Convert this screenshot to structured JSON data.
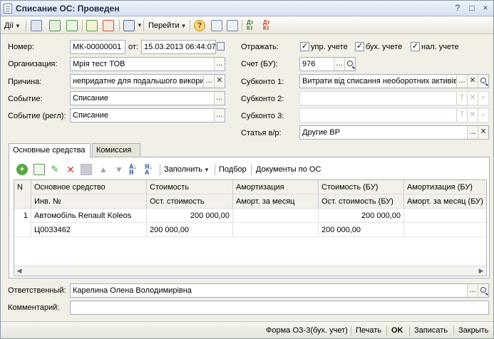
{
  "window": {
    "title": "Списание ОС: Проведен",
    "controls": [
      "?",
      "□",
      "×"
    ]
  },
  "toolbar": {
    "actions_label": "Дії",
    "goto_label": "Перейти",
    "help_label": "?",
    "dt_kt_label": "Дт Кт",
    "dt_kt_n_label": "Дт Кт"
  },
  "header": {
    "number_label": "Номер:",
    "number_value": "МК-00000001",
    "from_label": "от:",
    "date_value": "15.03.2013 06:44:07",
    "org_label": "Организация:",
    "org_value": "Мрія тест ТОВ",
    "reason_label": "Причина:",
    "reason_value": "непридатне для подальшого викори",
    "event_label": "Событие:",
    "event_value": "Списание",
    "event_reg_label": "Событие (регл):",
    "event_reg_value": "Списание",
    "reflect_label": "Отражать:",
    "reflect_options": [
      {
        "label": "упр. учете",
        "checked": true
      },
      {
        "label": "бух. учете",
        "checked": true
      },
      {
        "label": "нал. учете",
        "checked": true
      }
    ],
    "account_label": "Счет (БУ):",
    "account_value": "976",
    "subconto1_label": "Субконто 1:",
    "subconto1_value": "Витрати від списання необоротних активів",
    "subconto2_label": "Субконто 2:",
    "subconto2_value": "",
    "subconto3_label": "Субконто 3:",
    "subconto3_value": "",
    "article_label": "Статья в/р:",
    "article_value": "Другие ВР"
  },
  "tabs": [
    {
      "label": "Основные средства",
      "active": true
    },
    {
      "label": "Комиссия",
      "active": false
    }
  ],
  "table_toolbar": {
    "fill_label": "Заполнить",
    "select_label": "Подбор",
    "documents_label": "Документы по ОС"
  },
  "table": {
    "headers_row1": [
      "N",
      "Основное средство",
      "Стоимость",
      "Амортизация",
      "Стоимость (БУ)",
      "Амортизация (БУ)"
    ],
    "headers_row2": [
      "",
      "Инв. №",
      "Ост. стоимость",
      "Аморт. за месяц",
      "Ост. стоимость (БУ)",
      "Аморт. за месяц (БУ)"
    ],
    "rows": [
      {
        "n": "1",
        "asset": "Автомобіль Renault Koleos",
        "inv": "Ц0033462",
        "cost": "200 000,00",
        "residual": "200 000,00",
        "amort": "",
        "amort_month": "",
        "cost_bu": "200 000,00",
        "residual_bu": "200 000,00",
        "amort_bu": "",
        "amort_month_bu": ""
      }
    ]
  },
  "footer": {
    "responsible_label": "Ответственный:",
    "responsible_value": "Карелина Олена Володимирівна",
    "comment_label": "Комментарий:",
    "comment_value": ""
  },
  "statusbar": {
    "form_label": "Форма ОЗ-3(бух. учет)",
    "print_label": "Печать",
    "ok_label": "OK",
    "save_label": "Записать",
    "close_label": "Закрыть"
  }
}
